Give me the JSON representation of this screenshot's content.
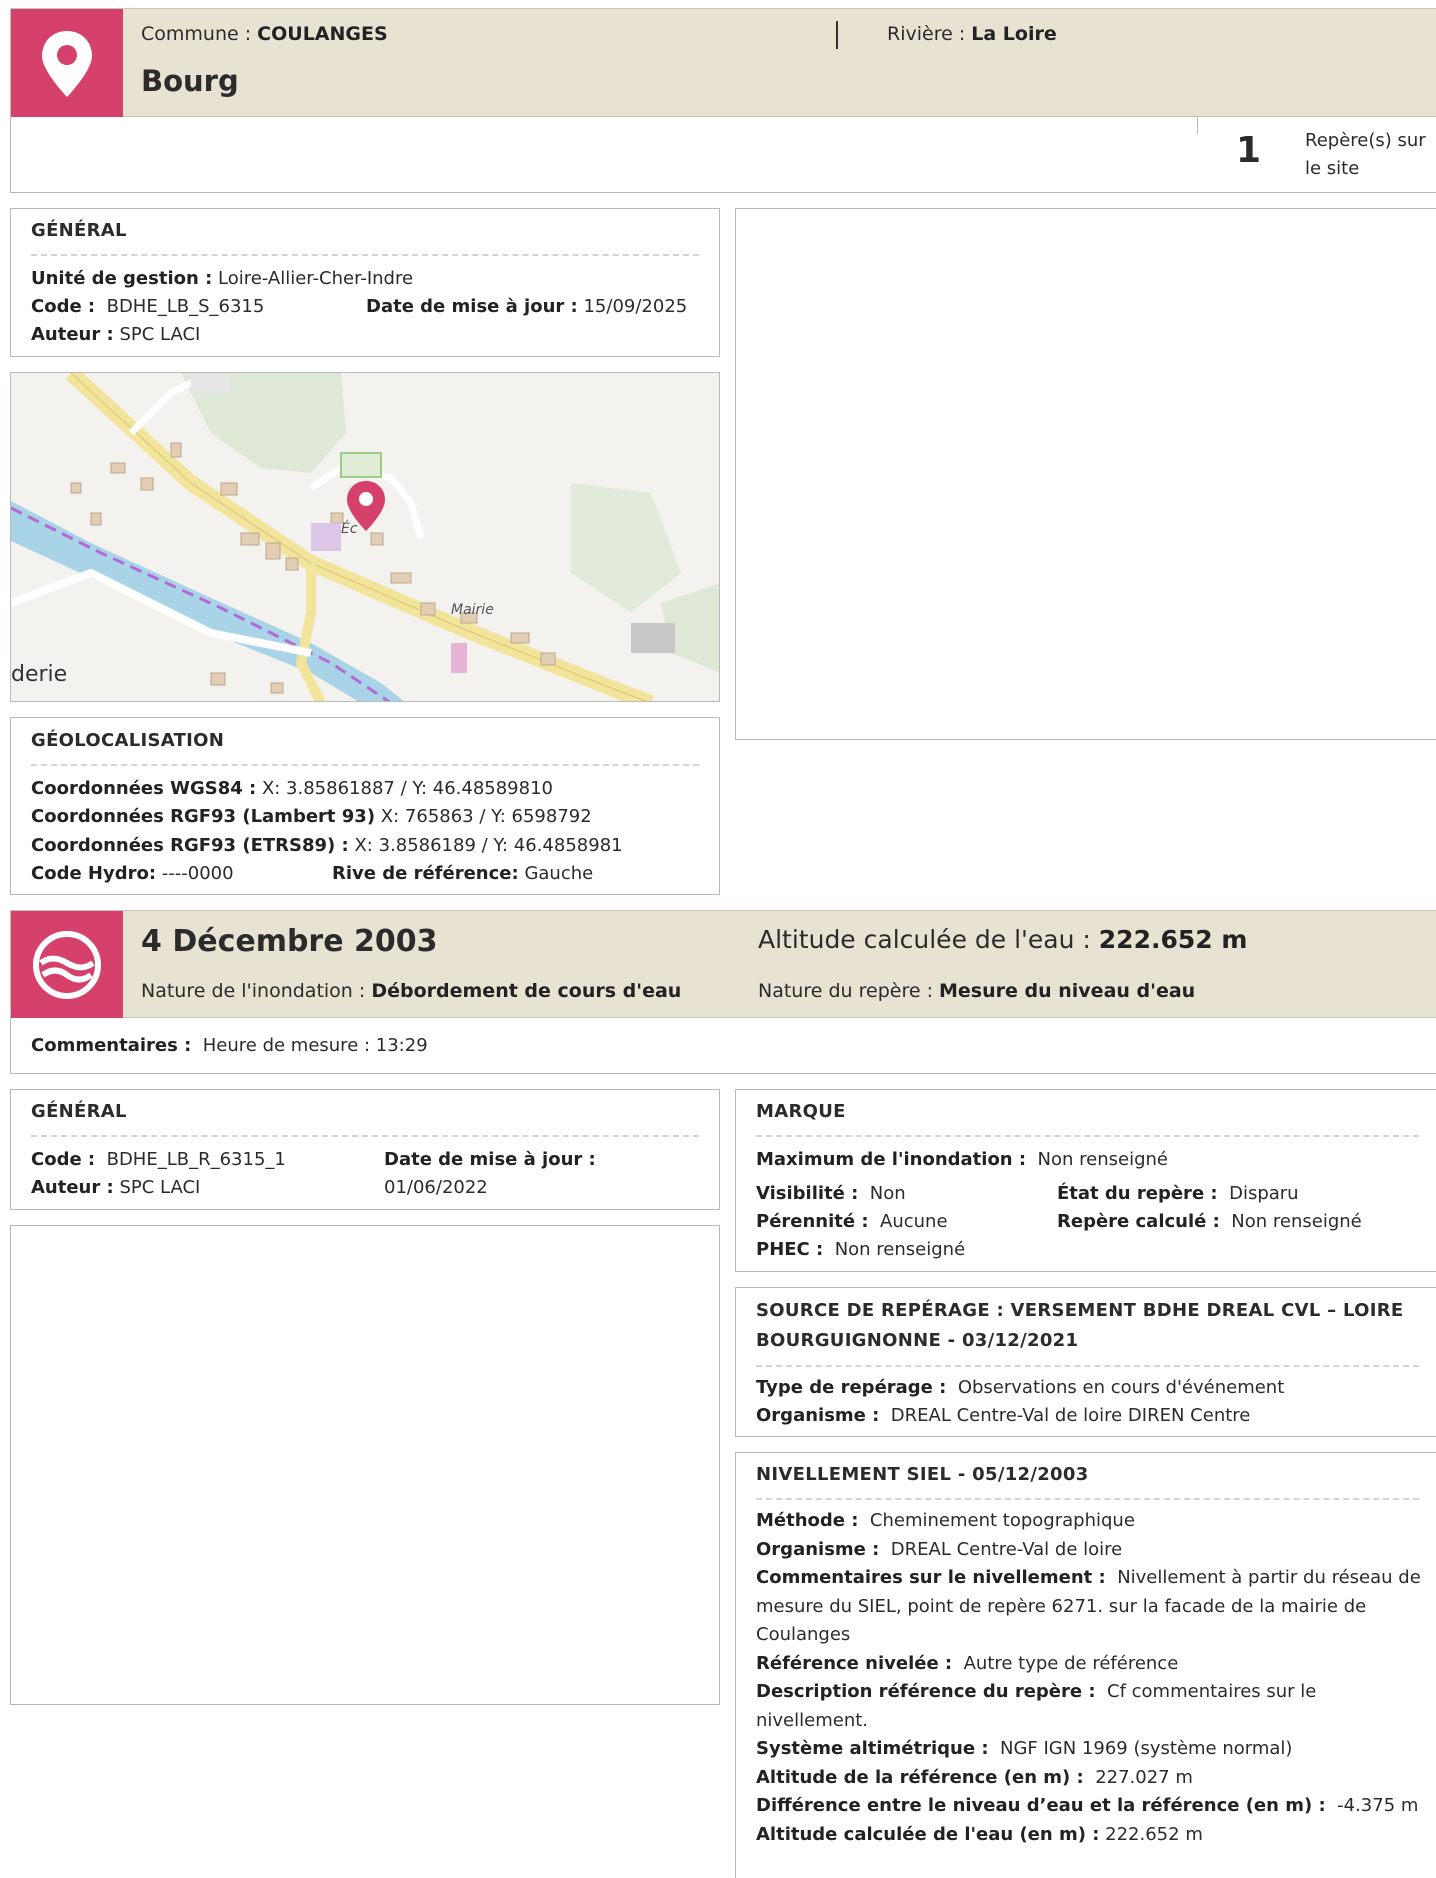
{
  "site": {
    "commune_label": "Commune : ",
    "commune": "COULANGES",
    "riviere_label": "Rivière : ",
    "riviere": "La Loire",
    "title": "Bourg",
    "reperes_count": "1",
    "reperes_label": "Repère(s) sur le site"
  },
  "general": {
    "title": "GÉNÉRAL",
    "unite_label": "Unité de gestion :",
    "unite": "Loire-Allier-Cher-Indre",
    "code_label": "Code :",
    "code": "BDHE_LB_S_6315",
    "date_label": "Date de mise à jour :",
    "date": "15/09/2025",
    "auteur_label": "Auteur :",
    "auteur": "SPC LACI"
  },
  "map": {
    "labels": [
      "derie",
      "Mairie",
      "Éc"
    ]
  },
  "geo": {
    "title": "GÉOLOCALISATION",
    "wgs_label": "Coordonnées WGS84 :",
    "wgs": "X: 3.85861887 / Y: 46.48589810",
    "rgf_lambert_label": "Coordonnées RGF93 (Lambert 93)",
    "rgf_lambert": "X: 765863 / Y: 6598792",
    "rgf_etrs_label": "Coordonnées RGF93 (ETRS89) :",
    "rgf_etrs": "X: 3.8586189 / Y: 46.4858981",
    "hydro_label": "Code Hydro:",
    "hydro": "----0000",
    "rive_label": "Rive de référence:",
    "rive": "Gauche"
  },
  "event": {
    "date": "4 Décembre 2003",
    "altitude_label": "Altitude calculée de l'eau : ",
    "altitude": "222.652 m",
    "nature_inond_label": "Nature de l'inondation : ",
    "nature_inond": "Débordement de cours d'eau",
    "nature_repere_label": "Nature du repère : ",
    "nature_repere": "Mesure du niveau d'eau",
    "commentaires_label": "Commentaires :",
    "commentaires": "Heure de mesure : 13:29"
  },
  "general2": {
    "title": "GÉNÉRAL",
    "code_label": "Code :",
    "code": "BDHE_LB_R_6315_1",
    "date_label": "Date de mise à jour :",
    "date": "01/06/2022",
    "auteur_label": "Auteur :",
    "auteur": "SPC LACI"
  },
  "marque": {
    "title": "MARQUE",
    "max_label": "Maximum de l'inondation :",
    "max": "Non renseigné",
    "visibilite_label": "Visibilité :",
    "visibilite": "Non",
    "etat_label": "État du repère :",
    "etat": "Disparu",
    "perennite_label": "Pérennité :",
    "perennite": "Aucune",
    "calcule_label": "Repère calculé :",
    "calcule": "Non renseigné",
    "phec_label": "PHEC :",
    "phec": "Non renseigné"
  },
  "source": {
    "title": "SOURCE DE REPÉRAGE : VERSEMENT BDHE DREAL CVL – LOIRE BOURGUIGNONNE - 03/12/2021",
    "type_label": "Type de repérage :",
    "type": "Observations en cours d'événement",
    "organisme_label": "Organisme :",
    "organisme": "DREAL Centre-Val de loire DIREN Centre"
  },
  "nivellement": {
    "title": "NIVELLEMENT SIEL - 05/12/2003",
    "methode_label": "Méthode :",
    "methode": "Cheminement topographique",
    "organisme_label": "Organisme :",
    "organisme": "DREAL Centre-Val de loire",
    "comment_label": "Commentaires sur le nivellement :",
    "comment": "Nivellement à partir du réseau de mesure du SIEL, point de repère 6271. sur la facade de la mairie de Coulanges",
    "ref_label": "Référence nivelée :",
    "ref": "Autre type de référence",
    "desc_label": "Description référence du repère :",
    "desc": "Cf commentaires sur le nivellement.",
    "systeme_label": "Système altimétrique :",
    "systeme": "NGF IGN 1969 (système normal)",
    "alt_ref_label": "Altitude de la référence (en m) :",
    "alt_ref": "227.027 m",
    "diff_label": "Différence entre le niveau d’eau et la référence (en m) :",
    "diff": "-4.375 m",
    "alt_eau_label": "Altitude calculée de l'eau (en m) :",
    "alt_eau": "222.652 m"
  },
  "colors": {
    "accent": "#d6416b",
    "header_bg": "#e8e2d2"
  }
}
